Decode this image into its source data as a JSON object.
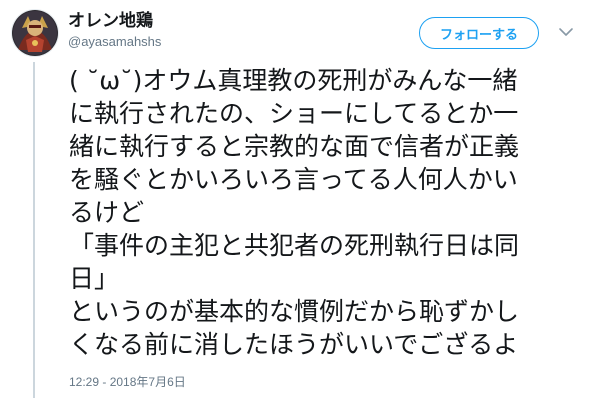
{
  "user": {
    "display_name": "オレン地鶏",
    "handle": "@ayasamahshs"
  },
  "follow_button": {
    "label": "フォローする"
  },
  "icons": {
    "avatar": "avatar-image",
    "menu": "chevron-down-icon"
  },
  "tweet": {
    "lines": [
      "( ˘ω˘)オウム真理教の死刑がみんな一緒",
      "に執行されたの、ショーにしてるとか一",
      "緒に執行すると宗教的な面で信者が正義",
      "を騒ぐとかいろいろ言ってる人何人かい",
      "るけど",
      "「事件の主犯と共犯者の死刑執行日は同",
      "日」",
      "というのが基本的な慣例だから恥ずかし",
      "くなる前に消したほうがいいでござるよ"
    ],
    "timestamp": "12:29 - 2018年7月6日"
  },
  "colors": {
    "accent": "#1da1f2",
    "secondary_text": "#657786",
    "thread_line": "#ccd6dd"
  }
}
